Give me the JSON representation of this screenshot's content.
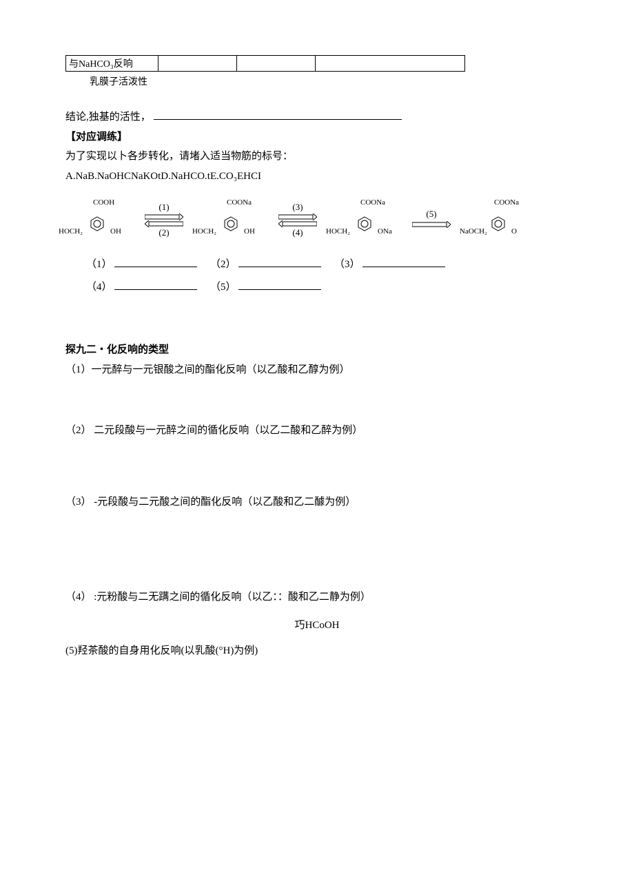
{
  "table": {
    "row_label": "与NaHCO₃反响"
  },
  "indent_caption": "乳膜子活泼性",
  "conclusion_line": "结论,独基的活性，",
  "heading_practice": "【对应调练】",
  "practice_intro": "为了实现以卜各步转化，请堵入适当物筋的标号：",
  "options_line": "A.NaB.NaOHCNaKOtD.NaHCO.tE.CO₃EHCI",
  "molecules": [
    {
      "top": "COOH",
      "left": "HOCH₂",
      "right": "OH"
    },
    {
      "top": "COONa",
      "left": "HOCH₂",
      "right": "OH"
    },
    {
      "top": "COONa",
      "left": "HOCH₂",
      "right": "ONa"
    },
    {
      "top": "COONa",
      "left": "NaOCH₂",
      "right": "O"
    }
  ],
  "arrow_labels": {
    "a1_top": "(1)",
    "a1_bot": "(2)",
    "a2_top": "(3)",
    "a2_bot": "(4)",
    "a3_top": "(5)"
  },
  "blanks": {
    "b1": "（1）",
    "b2": "（2）",
    "b3": "（3）",
    "b4": "（4）",
    "b5": "（5）"
  },
  "section2_heading": "探九二・化反响的类型",
  "items": [
    "（1）一元醉与一元银酸之间的酯化反响（以乙酸和乙醇为例）",
    "（2） 二元段酸与一元醉之间的循化反响（以乙二酸和乙醉为例）",
    "（3） -元段酸与二元酸之间的酯化反响（以乙酸和乙二醵为例）",
    "（4） :元粉酸与二无蹒之间的循化反响（以乙：：酸和乙二静为例）"
  ],
  "center_formula": "巧HCoOH",
  "item5": "(5)羟茶酸的自身用化反响(以乳酸(°H)为例)"
}
